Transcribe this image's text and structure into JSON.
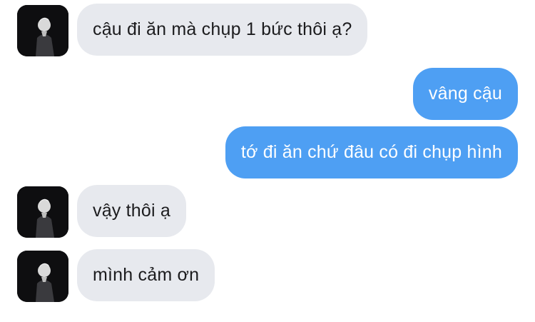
{
  "messages": [
    {
      "sender": "them",
      "text": "cậu đi ăn mà chụp 1 bức thôi ạ?"
    },
    {
      "sender": "me",
      "text": "vâng cậu"
    },
    {
      "sender": "me",
      "text": "tớ đi ăn chứ đâu có đi chụp hình"
    },
    {
      "sender": "them",
      "text": "vậy thôi ạ"
    },
    {
      "sender": "them",
      "text": "mình cảm ơn"
    }
  ],
  "colors": {
    "incoming_bubble": "#e7e9ee",
    "outgoing_bubble": "#4e9ff3",
    "incoming_text": "#1c1c1e",
    "outgoing_text": "#ffffff"
  },
  "avatar": {
    "icon": "contact-avatar-icon"
  }
}
